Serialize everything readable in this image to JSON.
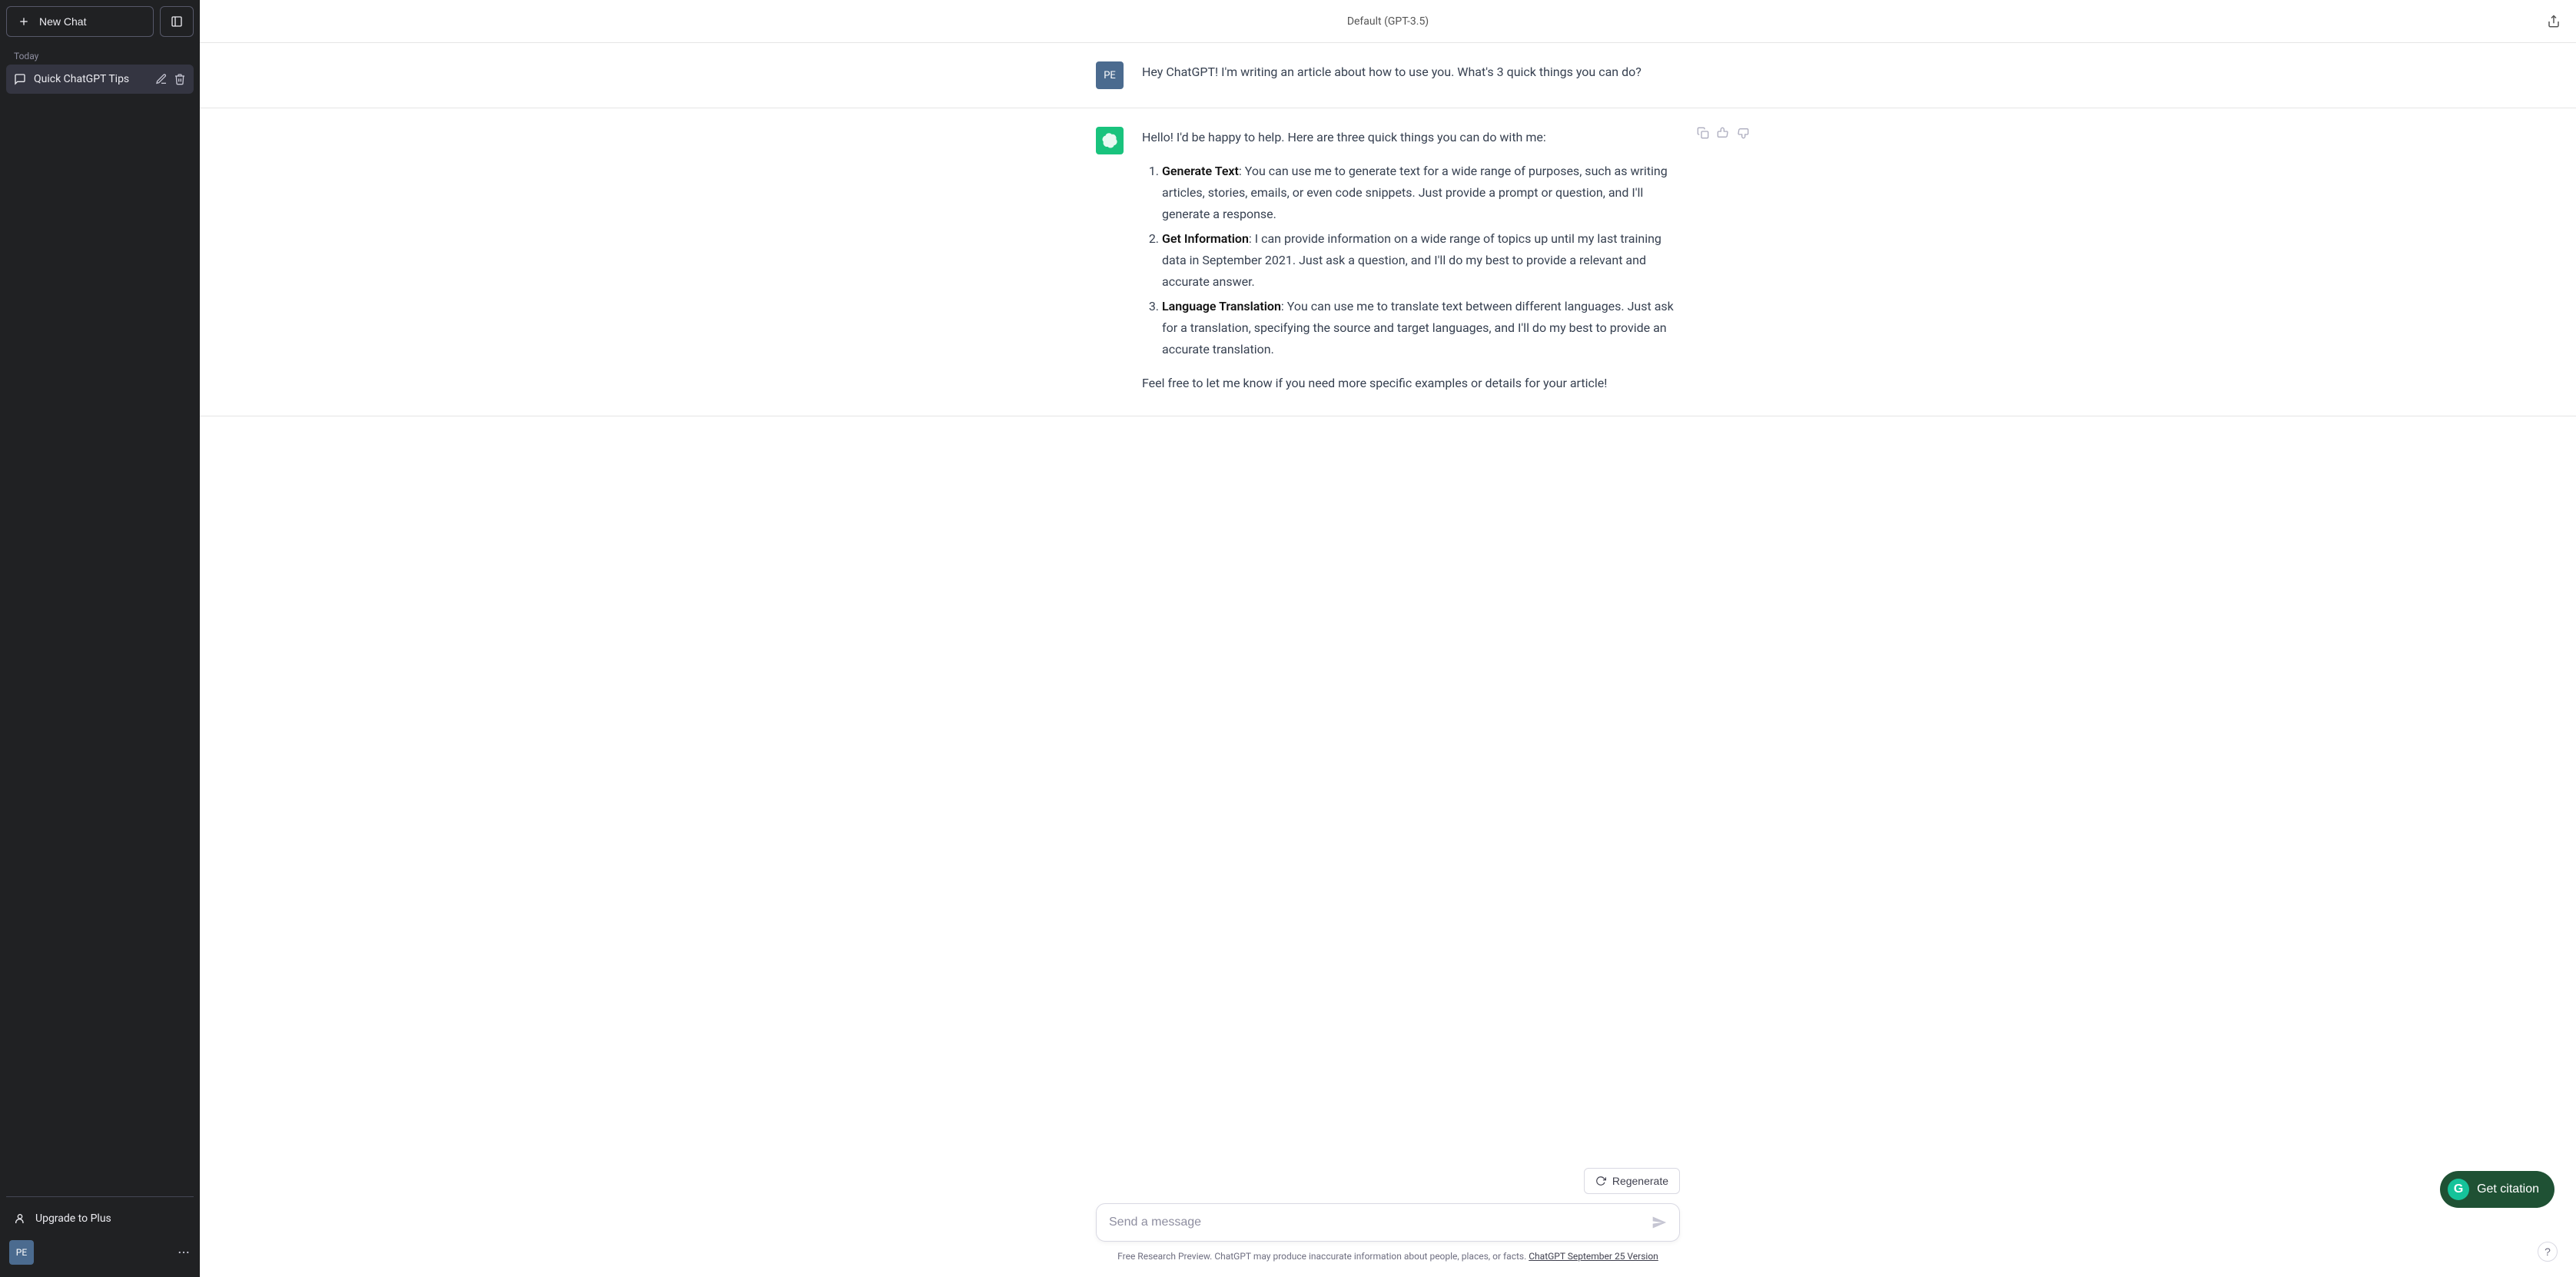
{
  "sidebar": {
    "new_chat_label": "New Chat",
    "section_label": "Today",
    "active_chat_title": "Quick ChatGPT Tips",
    "upgrade_label": "Upgrade to Plus",
    "user_initials": "PE"
  },
  "header": {
    "title": "Default (GPT-3.5)"
  },
  "conversation": {
    "user_avatar": "PE",
    "user_message": "Hey ChatGPT!  I'm writing an article about how to use you. What's 3 quick things you can do?",
    "assistant_intro": "Hello! I'd be happy to help. Here are three quick things you can do with me:",
    "item1_title": "Generate Text",
    "item1_body": ": You can use me to generate text for a wide range of purposes, such as writing articles, stories, emails, or even code snippets. Just provide a prompt or question, and I'll generate a response.",
    "item2_title": "Get Information",
    "item2_body": ": I can provide information on a wide range of topics up until my last training data in September 2021. Just ask a question, and I'll do my best to provide a relevant and accurate answer.",
    "item3_title": "Language Translation",
    "item3_body": ": You can use me to translate text between different languages. Just ask for a translation, specifying the source and target languages, and I'll do my best to provide an accurate translation.",
    "assistant_outro": "Feel free to let me know if you need more specific examples or details for your article!"
  },
  "composer": {
    "regenerate_label": "Regenerate",
    "placeholder": "Send a message",
    "disclaimer_text": "Free Research Preview. ChatGPT may produce inaccurate information about people, places, or facts. ",
    "version_link": "ChatGPT September 25 Version"
  },
  "floating": {
    "citation_label": "Get citation",
    "citation_badge": "G",
    "help_label": "?"
  }
}
